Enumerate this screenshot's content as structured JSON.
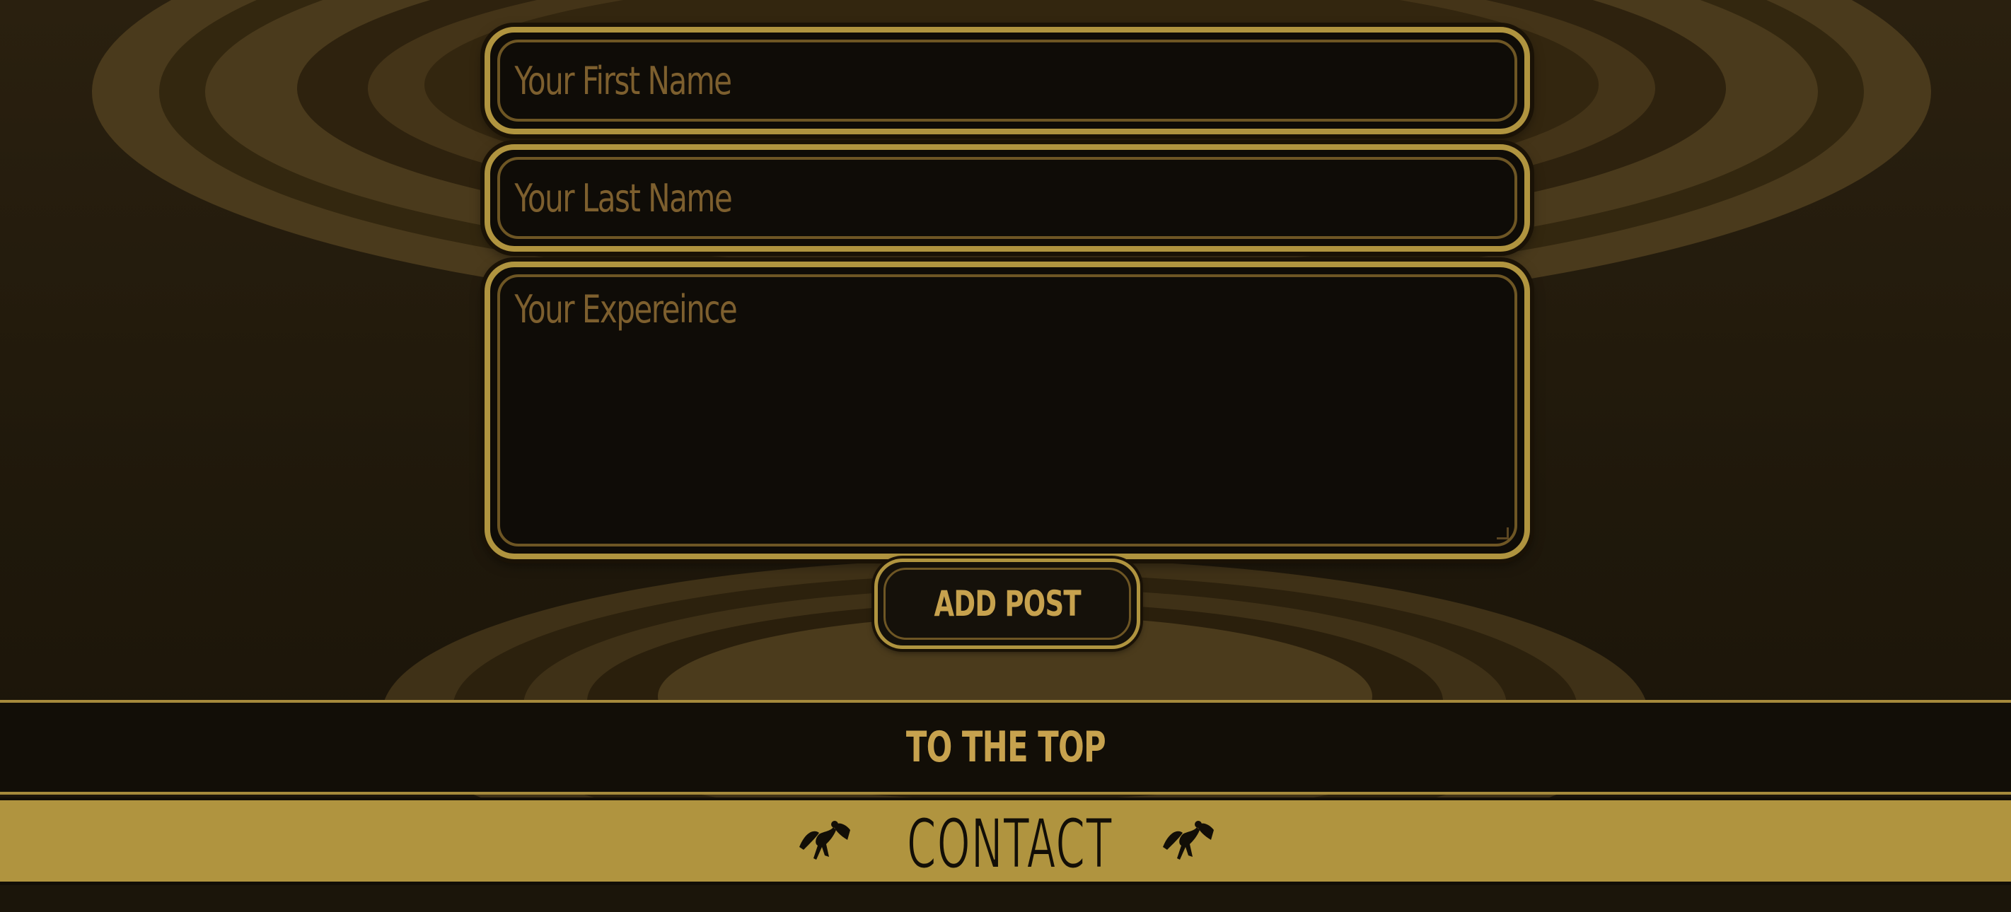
{
  "form": {
    "first_name_placeholder": "Your First Name",
    "last_name_placeholder": "Your Last Name",
    "experience_placeholder": "Your Expereince",
    "submit_label": "ADD POST"
  },
  "footer": {
    "to_top_label": "TO THE TOP",
    "contact_label": "CONTACT",
    "contact_icon": "winged-figure-icon"
  },
  "colors": {
    "gold": "#b0943f",
    "gold_text": "#c7a24e",
    "placeholder_brown": "#7d5f2e",
    "dark_field": "#0f0c07",
    "background": "#1f180b"
  }
}
